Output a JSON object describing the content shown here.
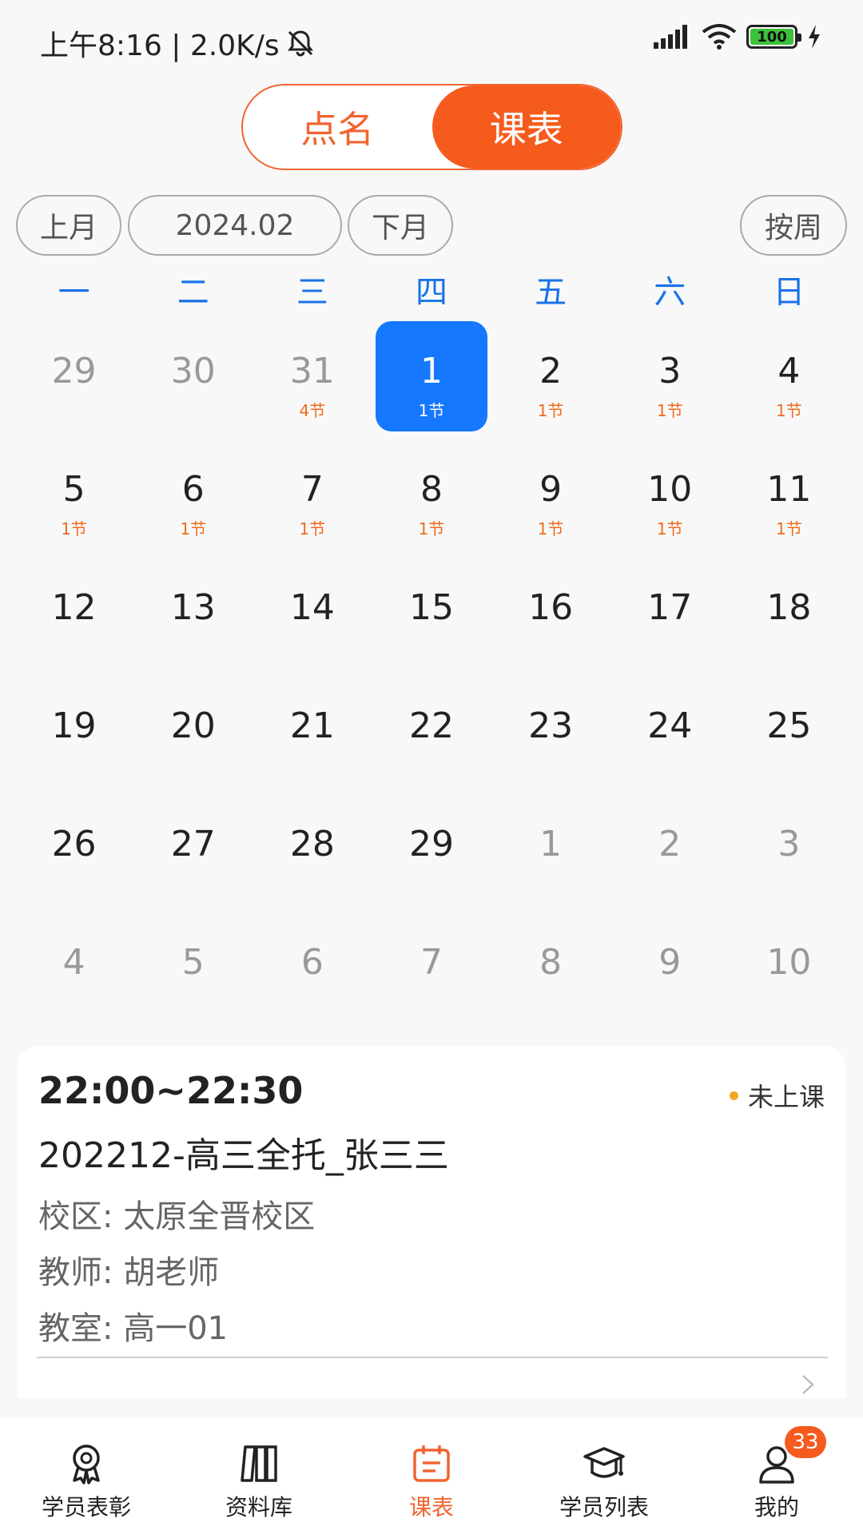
{
  "status_bar": {
    "time_speed": "上午8:16 | 2.0K/s",
    "battery": "100",
    "icons": [
      "bell-muted-icon",
      "signal-icon",
      "wifi-icon",
      "battery-icon",
      "charging-icon"
    ]
  },
  "toggle": {
    "left_label": "点名",
    "right_label": "课表",
    "active": "课表"
  },
  "month_nav": {
    "prev_label": "上月",
    "current": "2024.02",
    "next_label": "下月",
    "mode_label": "按周"
  },
  "weekdays": [
    "一",
    "二",
    "三",
    "四",
    "五",
    "六",
    "日"
  ],
  "calendar": [
    {
      "day": "29",
      "lessons": "",
      "dim": true
    },
    {
      "day": "30",
      "lessons": "",
      "dim": true
    },
    {
      "day": "31",
      "lessons": "4节",
      "dim": true
    },
    {
      "day": "1",
      "lessons": "1节",
      "selected": true
    },
    {
      "day": "2",
      "lessons": "1节"
    },
    {
      "day": "3",
      "lessons": "1节"
    },
    {
      "day": "4",
      "lessons": "1节"
    },
    {
      "day": "5",
      "lessons": "1节"
    },
    {
      "day": "6",
      "lessons": "1节"
    },
    {
      "day": "7",
      "lessons": "1节"
    },
    {
      "day": "8",
      "lessons": "1节"
    },
    {
      "day": "9",
      "lessons": "1节"
    },
    {
      "day": "10",
      "lessons": "1节"
    },
    {
      "day": "11",
      "lessons": "1节"
    },
    {
      "day": "12",
      "lessons": ""
    },
    {
      "day": "13",
      "lessons": ""
    },
    {
      "day": "14",
      "lessons": ""
    },
    {
      "day": "15",
      "lessons": ""
    },
    {
      "day": "16",
      "lessons": ""
    },
    {
      "day": "17",
      "lessons": ""
    },
    {
      "day": "18",
      "lessons": ""
    },
    {
      "day": "19",
      "lessons": ""
    },
    {
      "day": "20",
      "lessons": ""
    },
    {
      "day": "21",
      "lessons": ""
    },
    {
      "day": "22",
      "lessons": ""
    },
    {
      "day": "23",
      "lessons": ""
    },
    {
      "day": "24",
      "lessons": ""
    },
    {
      "day": "25",
      "lessons": ""
    },
    {
      "day": "26",
      "lessons": ""
    },
    {
      "day": "27",
      "lessons": ""
    },
    {
      "day": "28",
      "lessons": ""
    },
    {
      "day": "29",
      "lessons": ""
    },
    {
      "day": "1",
      "lessons": "",
      "dim": true
    },
    {
      "day": "2",
      "lessons": "",
      "dim": true
    },
    {
      "day": "3",
      "lessons": "",
      "dim": true
    },
    {
      "day": "4",
      "lessons": "",
      "dim": true
    },
    {
      "day": "5",
      "lessons": "",
      "dim": true
    },
    {
      "day": "6",
      "lessons": "",
      "dim": true
    },
    {
      "day": "7",
      "lessons": "",
      "dim": true
    },
    {
      "day": "8",
      "lessons": "",
      "dim": true
    },
    {
      "day": "9",
      "lessons": "",
      "dim": true
    },
    {
      "day": "10",
      "lessons": "",
      "dim": true
    }
  ],
  "lesson_card": {
    "time": "22:00~22:30",
    "status": "未上课",
    "status_color": "#f5a623",
    "class_name": "202212-高三全托_张三三",
    "campus_label": "校区: ",
    "campus": "太原全晋校区",
    "teacher_label": "教师: ",
    "teacher": "胡老师",
    "room_label": "教室: ",
    "room": "高一01"
  },
  "bottom_nav": {
    "items": [
      {
        "label": "学员表彰",
        "icon": "award-icon"
      },
      {
        "label": "资料库",
        "icon": "library-icon"
      },
      {
        "label": "课表",
        "icon": "calendar-icon",
        "active": true
      },
      {
        "label": "学员列表",
        "icon": "graduation-cap-icon"
      },
      {
        "label": "我的",
        "icon": "person-icon",
        "badge": "33"
      }
    ]
  },
  "colors": {
    "accent": "#f26430",
    "selected_day": "#1677ff",
    "weekday": "#1a73e8",
    "lesson_count": "#f06a1d"
  }
}
